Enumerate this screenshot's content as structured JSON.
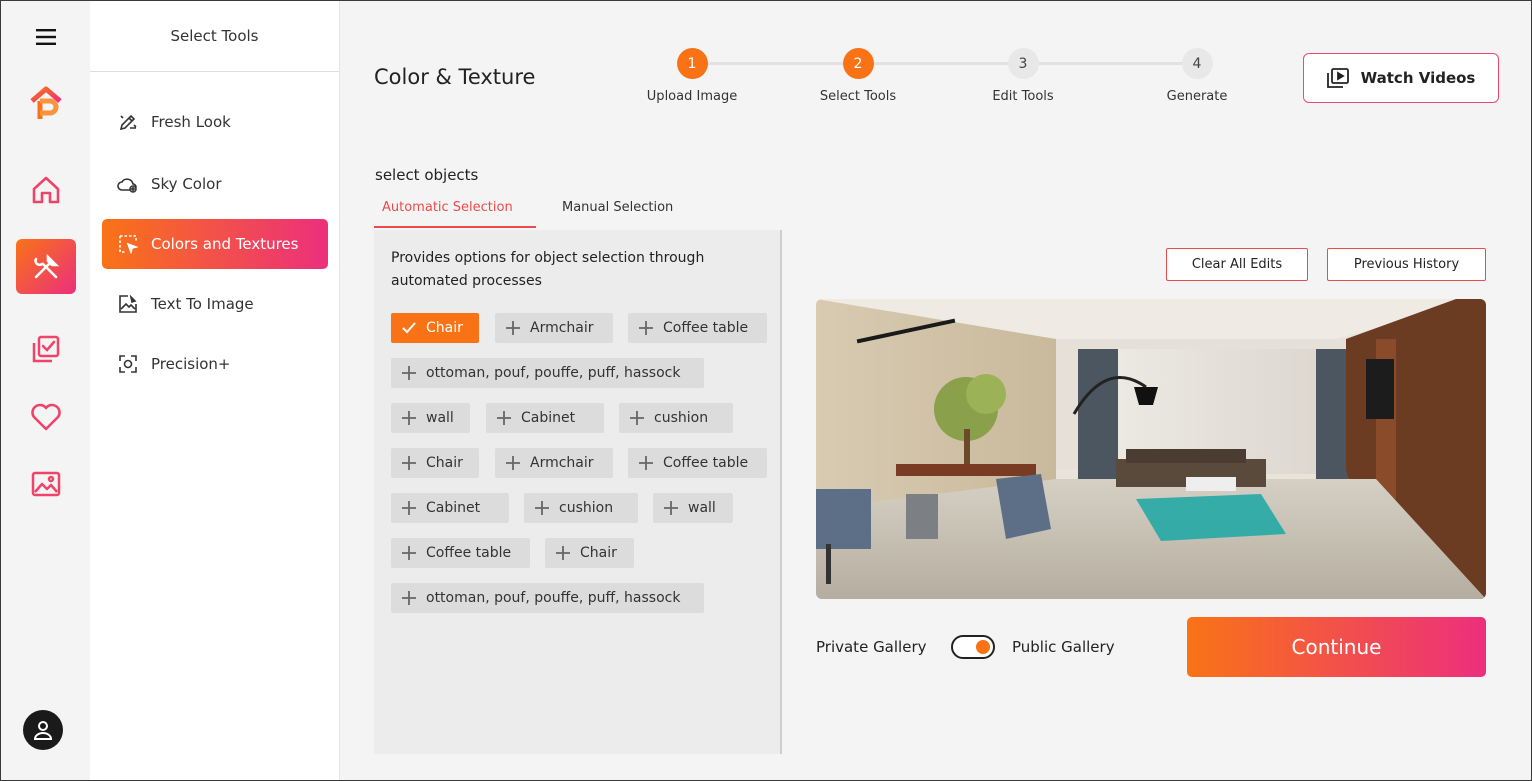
{
  "colors": {
    "accent_orange": "#f97316",
    "accent_pink": "#ec2f7d",
    "outline_red": "#ec4b4b"
  },
  "rail": {
    "items": [
      {
        "icon": "menu-icon"
      },
      {
        "icon": "logo-icon"
      },
      {
        "icon": "home-icon"
      },
      {
        "icon": "tools-icon",
        "active": true
      },
      {
        "icon": "checklist-icon"
      },
      {
        "icon": "heart-icon"
      },
      {
        "icon": "image-icon"
      }
    ],
    "account_icon": "user-icon"
  },
  "tools_panel": {
    "title": "Select Tools",
    "items": [
      {
        "label": "Fresh Look",
        "icon": "pen-sparkle-icon"
      },
      {
        "label": "Sky Color",
        "icon": "cloud-icon"
      },
      {
        "label": "Colors and Textures",
        "icon": "select-cursor-icon",
        "active": true
      },
      {
        "label": "Text To Image",
        "icon": "image-edit-icon"
      },
      {
        "label": "Precision+",
        "icon": "focus-icon"
      }
    ]
  },
  "header": {
    "title": "Color & Texture",
    "steps": [
      {
        "number": "1",
        "label": "Upload Image",
        "done": true
      },
      {
        "number": "2",
        "label": "Select Tools",
        "done": true
      },
      {
        "number": "3",
        "label": "Edit Tools",
        "done": false
      },
      {
        "number": "4",
        "label": "Generate",
        "done": false
      }
    ],
    "watch_videos": "Watch Videos"
  },
  "selection": {
    "label": "select objects",
    "tabs": [
      {
        "label": "Automatic Selection",
        "active": true
      },
      {
        "label": "Manual Selection",
        "active": false
      }
    ],
    "description": "Provides options for object selection through automated processes",
    "chips": [
      {
        "label": "Chair",
        "selected": true
      },
      {
        "label": "Armchair",
        "selected": false
      },
      {
        "label": "Coffee table",
        "selected": false
      },
      {
        "label": "ottoman, pouf, pouffe, puff, hassock",
        "selected": false
      },
      {
        "label": "wall",
        "selected": false
      },
      {
        "label": "Cabinet",
        "selected": false
      },
      {
        "label": "cushion",
        "selected": false
      },
      {
        "label": "Chair",
        "selected": false
      },
      {
        "label": "Armchair",
        "selected": false
      },
      {
        "label": "Coffee table",
        "selected": false
      },
      {
        "label": "Cabinet",
        "selected": false
      },
      {
        "label": "cushion",
        "selected": false
      },
      {
        "label": "wall",
        "selected": false
      },
      {
        "label": "Coffee table",
        "selected": false
      },
      {
        "label": "Chair",
        "selected": false
      },
      {
        "label": "ottoman, pouf, pouffe, puff, hassock",
        "selected": false
      }
    ]
  },
  "preview": {
    "clear_edits": "Clear All Edits",
    "previous_history": "Previous History"
  },
  "footer": {
    "private_gallery": "Private Gallery",
    "public_gallery": "Public Gallery",
    "gallery_public": true,
    "continue": "Continue"
  }
}
